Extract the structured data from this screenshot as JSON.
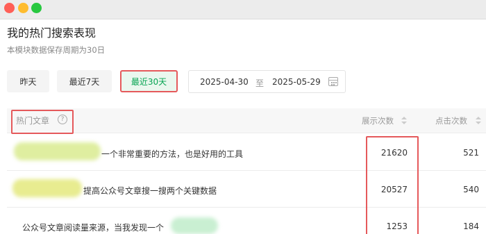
{
  "page": {
    "title": "我的热门搜索表现",
    "subtitle": "本模块数据保存周期为30日"
  },
  "colors": {
    "accent_red": "#e5595b",
    "active_green": "#07a452",
    "active_bg": "#eaf7ee"
  },
  "icons": {
    "window_controls": [
      "close-dot-icon",
      "minimize-dot-icon",
      "zoom-dot-icon"
    ],
    "calendar": "calendar-icon",
    "help": "help-circle-icon",
    "sort": "sort-icon"
  },
  "filters": {
    "ranges": [
      {
        "label": "昨天",
        "active": false
      },
      {
        "label": "最近7天",
        "active": false
      },
      {
        "label": "最近30天",
        "active": true
      }
    ],
    "date_range": {
      "start": "2025-04-30",
      "separator": "至",
      "end": "2025-05-29"
    }
  },
  "table": {
    "columns": {
      "title": "热门文章",
      "help_glyph": "?",
      "impressions": "展示次数",
      "clicks": "点击次数"
    },
    "rows": [
      {
        "title": "一个非常重要的方法，也是好用的工具",
        "impressions": "21620",
        "clicks": "521"
      },
      {
        "title": "提高公众号文章搜一搜两个关键数据",
        "impressions": "20527",
        "clicks": "540"
      },
      {
        "title": "公众号文章阅读量来源，当我发现一个",
        "impressions": "1253",
        "clicks": "184"
      }
    ]
  }
}
